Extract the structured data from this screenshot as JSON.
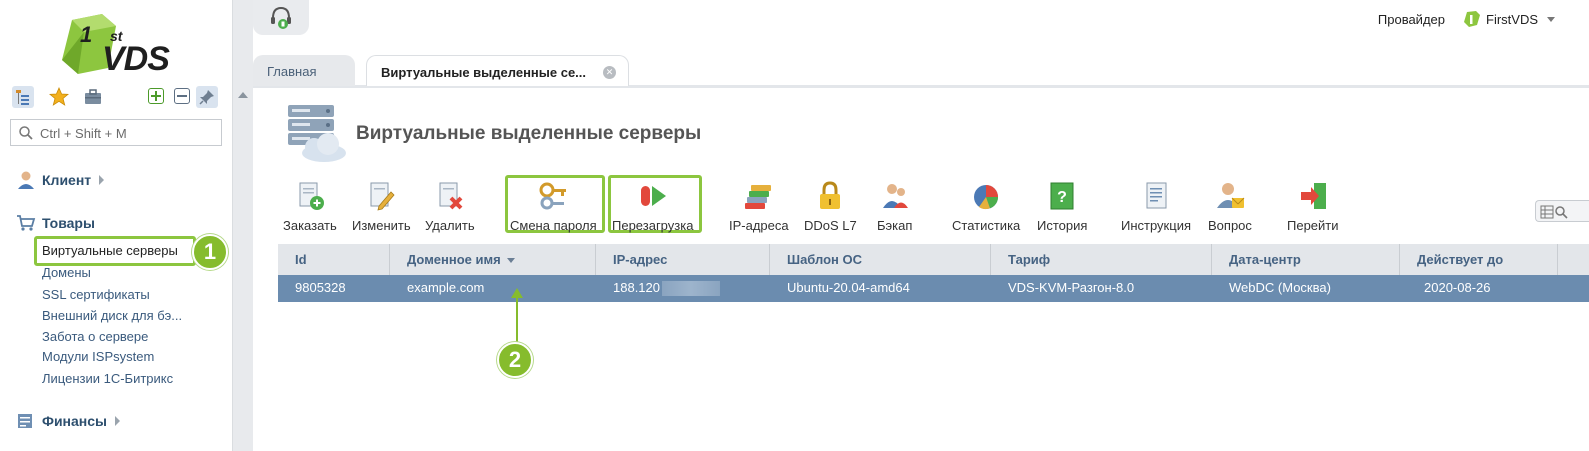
{
  "sidebar": {
    "logo_text": "VDS",
    "logo_superscript": "st",
    "search_placeholder": "Ctrl + Shift + M",
    "sections": {
      "client": "Клиент",
      "products": "Товары",
      "finance": "Финансы"
    },
    "product_items": [
      "Виртуальные серверы",
      "Домены",
      "SSL сертификаты",
      "Внешний диск для бэ...",
      "Забота о сервере",
      "Модули ISPsystem",
      "Лицензии 1С-Битрикс"
    ]
  },
  "topbar": {
    "provider_label": "Провайдер",
    "account_name": "FirstVDS"
  },
  "tabs": [
    {
      "label": "Главная"
    },
    {
      "label": "Виртуальные выделенные се..."
    }
  ],
  "page": {
    "title": "Виртуальные выделенные серверы"
  },
  "toolbar": [
    {
      "label": "Заказать",
      "icon": "order-icon"
    },
    {
      "label": "Изменить",
      "icon": "edit-icon"
    },
    {
      "label": "Удалить",
      "icon": "delete-icon"
    },
    {
      "label": "Смена пароля",
      "icon": "key-icon"
    },
    {
      "label": "Перезагрузка",
      "icon": "reboot-icon"
    },
    {
      "label": "IP-адреса",
      "icon": "ip-icon"
    },
    {
      "label": "DDoS L7",
      "icon": "lock-icon"
    },
    {
      "label": "Бэкап",
      "icon": "backup-icon"
    },
    {
      "label": "Статистика",
      "icon": "pie-chart-icon"
    },
    {
      "label": "История",
      "icon": "history-icon"
    },
    {
      "label": "Инструкция",
      "icon": "manual-icon"
    },
    {
      "label": "Вопрос",
      "icon": "question-icon"
    },
    {
      "label": "Перейти",
      "icon": "goto-icon"
    }
  ],
  "table": {
    "columns": [
      "Id",
      "Доменное имя",
      "IP-адрес",
      "Шаблон ОС",
      "Тариф",
      "Дата-центр",
      "Действует до"
    ],
    "rows": [
      [
        "9805328",
        "example.com",
        "188.120",
        "Ubuntu-20.04-amd64",
        "VDS-KVM-Разгон-8.0",
        "WebDC (Москва)",
        "2020-08-26"
      ]
    ]
  },
  "callouts": [
    "1",
    "2"
  ],
  "colors": {
    "accent_green": "#8cc63f",
    "selected_row": "#6b8caf",
    "header_bg": "#e3e6ea",
    "link_blue": "#3a5a7d"
  }
}
